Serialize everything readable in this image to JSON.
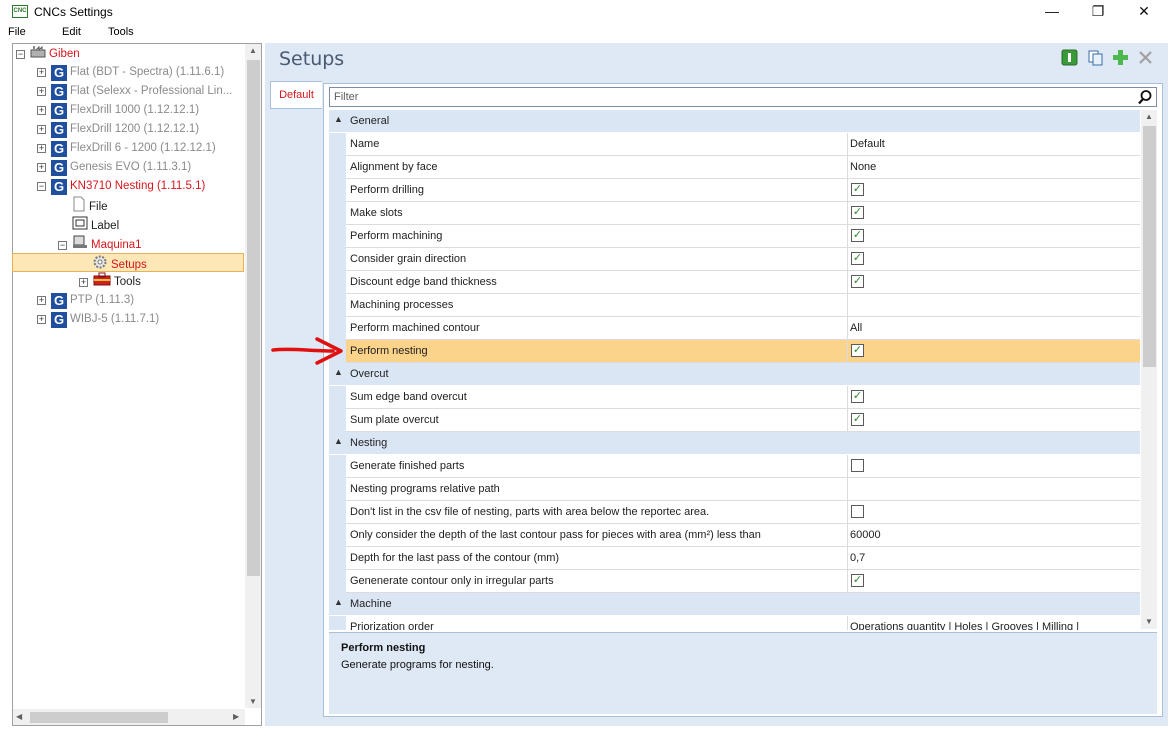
{
  "window": {
    "title": "CNCs Settings",
    "icon_text": "CNC",
    "minimize": "—",
    "maximize": "❐",
    "close": "✕"
  },
  "menu": [
    "File",
    "Edit",
    "Tools"
  ],
  "tree": [
    {
      "label": "Giben",
      "indent": 0,
      "expander": "minus",
      "icon": "factory-icon",
      "style": "red"
    },
    {
      "label": "Flat (BDT - Spectra) (1.11.6.1)",
      "indent": 1,
      "expander": "plus",
      "icon": "g",
      "style": "gray"
    },
    {
      "label": "Flat (Selexx - Professional Lin...",
      "indent": 1,
      "expander": "plus",
      "icon": "g",
      "style": "gray"
    },
    {
      "label": "FlexDrill 1000 (1.12.12.1)",
      "indent": 1,
      "expander": "plus",
      "icon": "g",
      "style": "gray"
    },
    {
      "label": "FlexDrill 1200 (1.12.12.1)",
      "indent": 1,
      "expander": "plus",
      "icon": "g",
      "style": "gray"
    },
    {
      "label": "FlexDrill 6 - 1200 (1.12.12.1)",
      "indent": 1,
      "expander": "plus",
      "icon": "g",
      "style": "gray"
    },
    {
      "label": "Genesis EVO (1.11.3.1)",
      "indent": 1,
      "expander": "plus",
      "icon": "g",
      "style": "gray"
    },
    {
      "label": "KN3710 Nesting (1.11.5.1)",
      "indent": 1,
      "expander": "minus",
      "icon": "g",
      "style": "red"
    },
    {
      "label": "File",
      "indent": 2,
      "expander": "",
      "icon": "file-icon",
      "style": ""
    },
    {
      "label": "Label",
      "indent": 2,
      "expander": "",
      "icon": "label-icon",
      "style": ""
    },
    {
      "label": "Maquina1",
      "indent": 2,
      "expander": "minus",
      "icon": "machine-icon",
      "style": "red"
    },
    {
      "label": "Setups",
      "indent": 3,
      "expander": "",
      "icon": "gear-icon",
      "style": "red",
      "selected": true
    },
    {
      "label": "Tools",
      "indent": 3,
      "expander": "plus",
      "icon": "toolbox-icon",
      "style": ""
    },
    {
      "label": "PTP (1.11.3)",
      "indent": 1,
      "expander": "plus",
      "icon": "g",
      "style": "gray"
    },
    {
      "label": "WIBJ-5 (1.11.7.1)",
      "indent": 1,
      "expander": "plus",
      "icon": "g",
      "style": "gray"
    }
  ],
  "main": {
    "title": "Setups",
    "toolbar_icons": [
      "info-icon",
      "copy-icon",
      "add-icon",
      "delete-icon"
    ],
    "tab": "Default",
    "filter_placeholder": "Filter",
    "search_glyph": "⚲"
  },
  "grid": [
    {
      "type": "category",
      "label": "General"
    },
    {
      "type": "prop",
      "name": "Name",
      "value": "Default"
    },
    {
      "type": "prop",
      "name": "Alignment by face",
      "value": "None"
    },
    {
      "type": "prop",
      "name": "Perform drilling",
      "check": true
    },
    {
      "type": "prop",
      "name": "Make slots",
      "check": true
    },
    {
      "type": "prop",
      "name": "Perform machining",
      "check": true
    },
    {
      "type": "prop",
      "name": "Consider grain direction",
      "check": true
    },
    {
      "type": "prop",
      "name": "Discount edge band thickness",
      "check": true
    },
    {
      "type": "prop",
      "name": "Machining processes",
      "value": ""
    },
    {
      "type": "prop",
      "name": "Perform machined contour",
      "value": "All"
    },
    {
      "type": "prop",
      "name": "Perform nesting",
      "check": true,
      "highlight": true
    },
    {
      "type": "category",
      "label": "Overcut"
    },
    {
      "type": "prop",
      "name": "Sum edge band overcut",
      "check": true
    },
    {
      "type": "prop",
      "name": "Sum plate overcut",
      "check": true
    },
    {
      "type": "category",
      "label": "Nesting"
    },
    {
      "type": "prop",
      "name": "Generate finished parts",
      "check": false
    },
    {
      "type": "prop",
      "name": "Nesting programs relative path",
      "value": ""
    },
    {
      "type": "prop",
      "name": "Don't list in the csv file of nesting, parts with area below the reportec area.",
      "check": false
    },
    {
      "type": "prop",
      "name": "Only consider the depth of the last contour pass for pieces with area (mm²) less than",
      "value": "60000"
    },
    {
      "type": "prop",
      "name": "Depth for the last pass of the contour (mm)",
      "value": "0,7"
    },
    {
      "type": "prop",
      "name": "Genenerate contour only in irregular parts",
      "check": true
    },
    {
      "type": "category",
      "label": "Machine"
    },
    {
      "type": "prop",
      "name": "Priorization order",
      "value": "Operations quantity | Holes | Grooves | Milling |"
    }
  ],
  "description": {
    "title": "Perform nesting",
    "text": "Generate programs for nesting."
  },
  "colors": {
    "accent_red": "#d8161c",
    "highlight": "#fbd38b",
    "category": "#dbe6f4",
    "check": "#2b8a2b"
  }
}
